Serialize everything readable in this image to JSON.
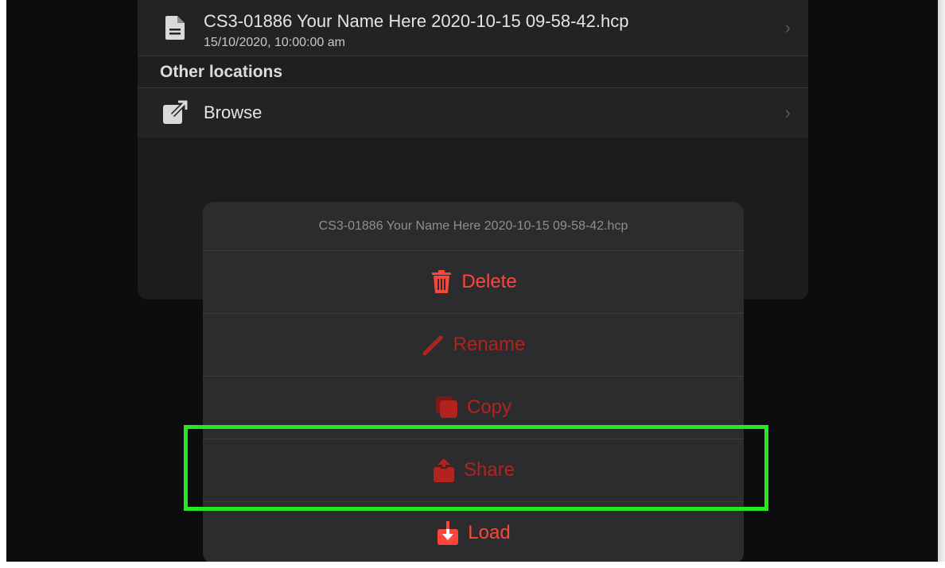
{
  "file_list": {
    "file": {
      "name": "CS3-01886 Your Name Here 2020-10-15 09-58-42.hcp",
      "date": "15/10/2020, 10:00:00 am",
      "icon": "document-icon"
    },
    "section_title": "Other locations",
    "browse": {
      "label": "Browse",
      "icon": "external-link-icon"
    }
  },
  "action_sheet": {
    "title": "CS3-01886 Your Name Here 2020-10-15 09-58-42.hcp",
    "actions": [
      {
        "label": "Delete",
        "icon": "trash-icon",
        "color": "#ff453a"
      },
      {
        "label": "Rename",
        "icon": "pencil-icon",
        "color": "#b3231d"
      },
      {
        "label": "Copy",
        "icon": "copy-icon",
        "color": "#b3231d"
      },
      {
        "label": "Share",
        "icon": "share-icon",
        "color": "#b3231d"
      },
      {
        "label": "Load",
        "icon": "download-icon",
        "color": "#ff453a"
      }
    ]
  },
  "colors": {
    "highlight": "#25e81f",
    "background": "#0d0d0d",
    "sheet": "#2c2c2e"
  }
}
